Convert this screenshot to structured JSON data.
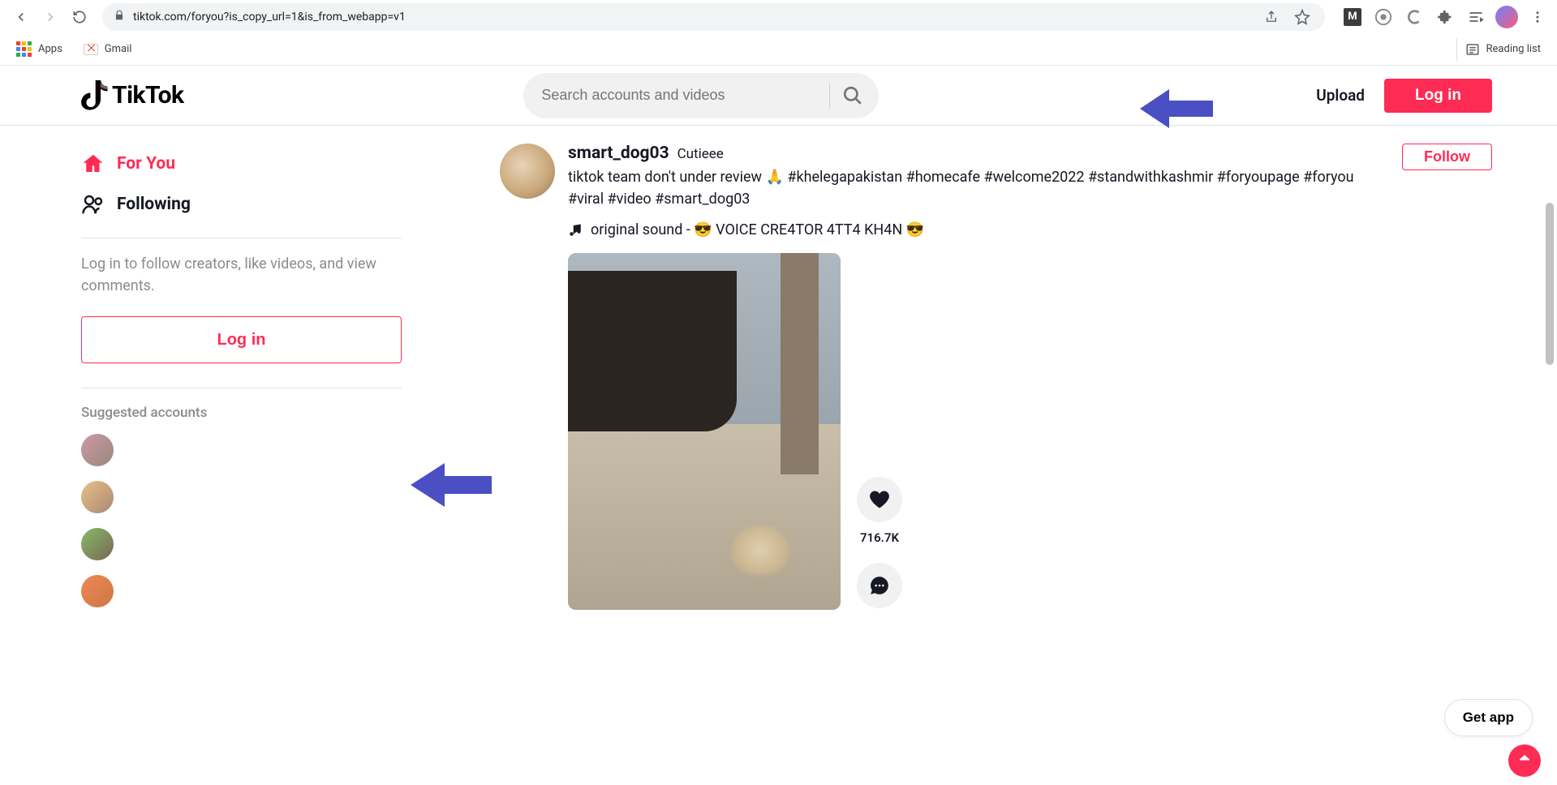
{
  "browser": {
    "url": "tiktok.com/foryou?is_copy_url=1&is_from_webapp=v1",
    "bookmarks": {
      "apps": "Apps",
      "gmail": "Gmail"
    },
    "reading_list": "Reading list"
  },
  "header": {
    "logo_text": "TikTok",
    "search_placeholder": "Search accounts and videos",
    "upload_label": "Upload",
    "login_label": "Log in"
  },
  "sidebar": {
    "for_you": "For You",
    "following": "Following",
    "login_prompt": "Log in to follow creators, like videos, and view comments.",
    "login_button": "Log in",
    "suggested_header": "Suggested accounts"
  },
  "post": {
    "username": "smart_dog03",
    "nickname": "Cutieee",
    "caption": "tiktok team don't under review 🙏 #khelegapakistan #homecafe #welcome2022 #standwithkashmir #foryoupage #foryou #viral #video #smart_dog03",
    "sound": "original sound - 😎 VOICE CRE4TOR 4TT4 KH4N 😎",
    "follow_label": "Follow",
    "like_count": "716.7K"
  },
  "floating": {
    "get_app": "Get app"
  },
  "colors": {
    "accent": "#fe2c55",
    "arrow": "#4a4fc4"
  }
}
